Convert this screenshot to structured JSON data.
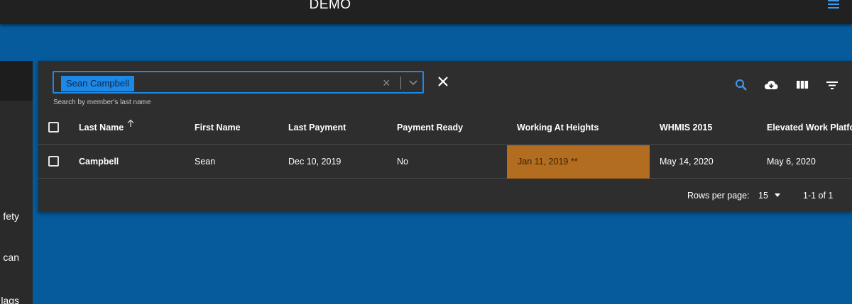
{
  "app": {
    "title": "DEMO"
  },
  "sidebar": {
    "items": [
      "fety",
      "can",
      "lags"
    ]
  },
  "search": {
    "chip": "Sean Campbell",
    "helper": "Search by member's last name"
  },
  "table": {
    "headers": {
      "last_name": "Last Name",
      "first_name": "First Name",
      "last_payment": "Last Payment",
      "payment_ready": "Payment Ready",
      "working_at_heights": "Working At Heights",
      "whmis_2015": "WHMIS 2015",
      "elevated_work_platform": "Elevated Work Platfor"
    },
    "rows": [
      {
        "last_name": "Campbell",
        "first_name": "Sean",
        "last_payment": "Dec 10, 2019",
        "payment_ready": "No",
        "working_at_heights": "Jan 11, 2019 **",
        "whmis_2015": "May 14, 2020",
        "elevated_work_platform": "May 6, 2020"
      }
    ]
  },
  "pagination": {
    "rows_per_page_label": "Rows per page:",
    "rows_per_page_value": "15",
    "range": "1-1 of 1"
  },
  "colors": {
    "page_bg": "#065b9c",
    "appbar": "#212121",
    "card": "#2e2e2e",
    "accent": "#1e88e5",
    "warning_cell": "#b26d20"
  },
  "icons": [
    "menu-icon",
    "search-icon",
    "cloud-download-icon",
    "view-column-icon",
    "filter-icon",
    "close-icon",
    "chevron-down-icon",
    "arrow-up-icon"
  ]
}
